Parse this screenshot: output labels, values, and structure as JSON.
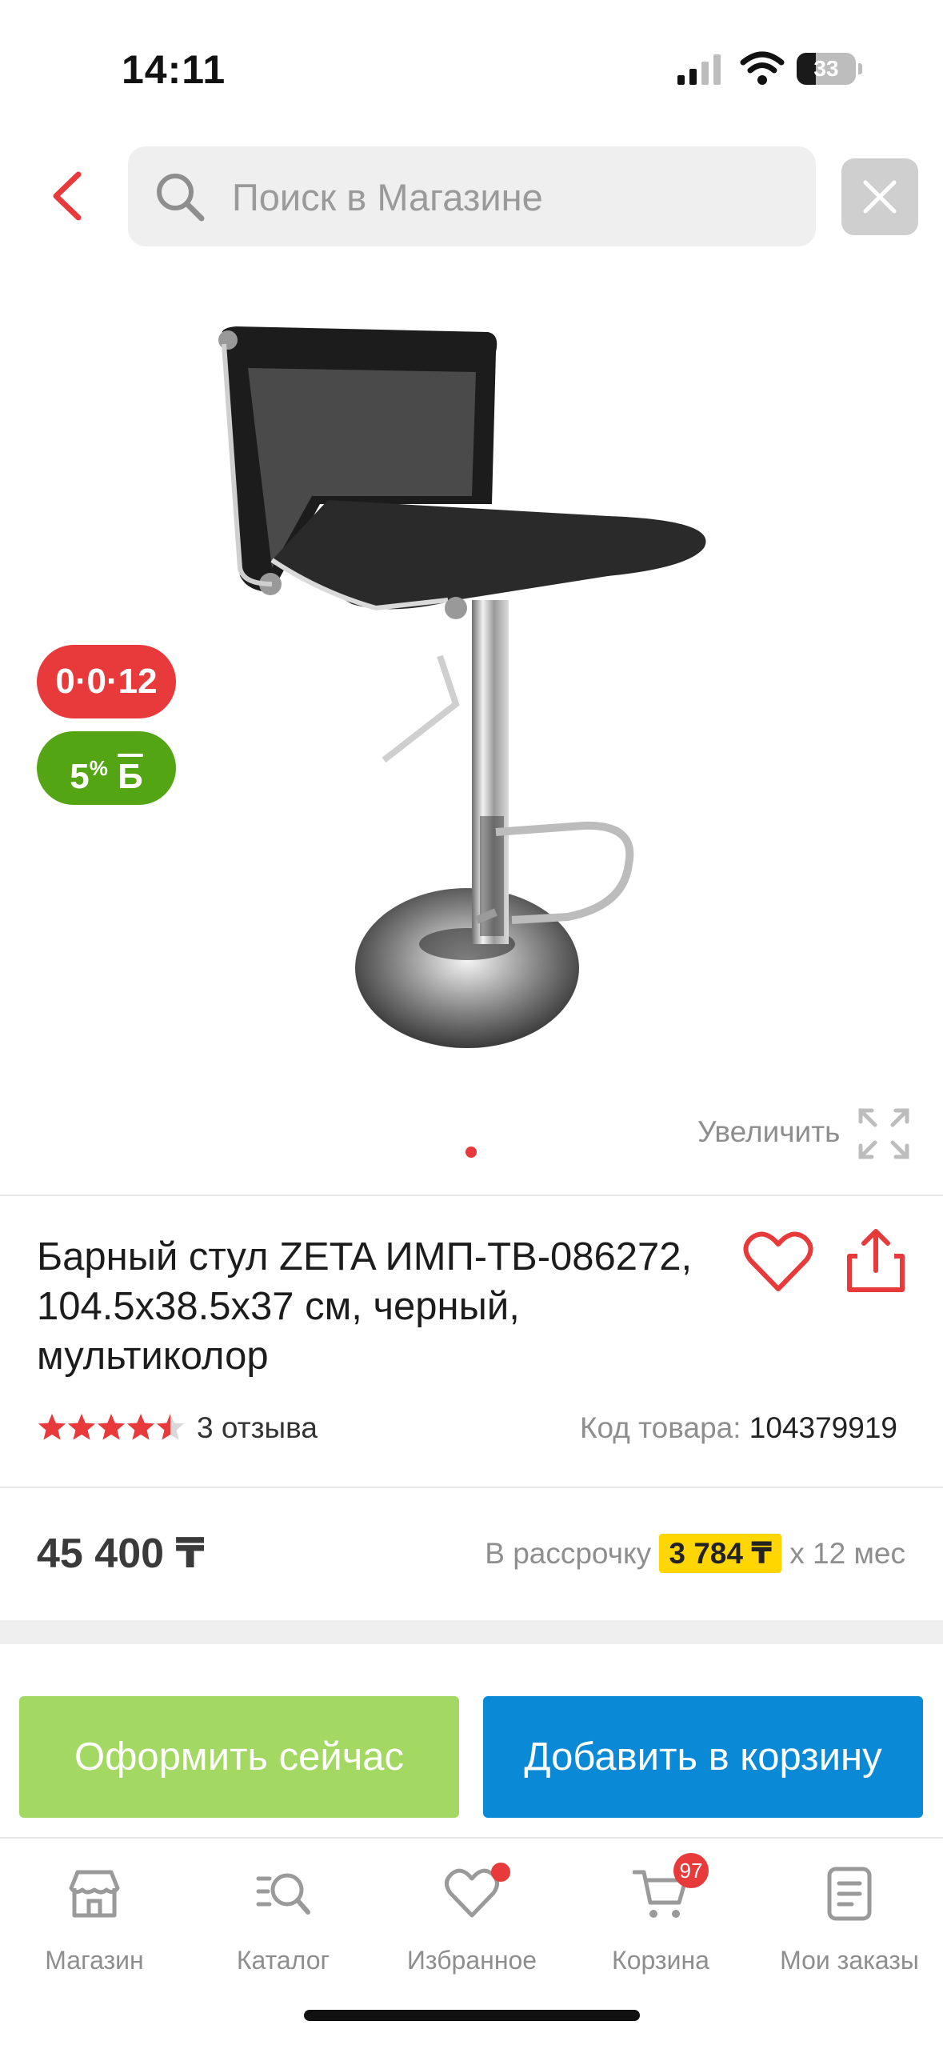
{
  "status_bar": {
    "time": "14:11",
    "battery": "33",
    "battery_level": 0.33
  },
  "search": {
    "placeholder": "Поиск в Магазине"
  },
  "icons": {
    "back": "chevron-left-icon",
    "search": "search-icon",
    "close": "close-icon",
    "zoom": "expand-icon",
    "favorite": "heart-icon",
    "share": "share-icon"
  },
  "badges": {
    "installment": "0·0·12",
    "bonus_value": "5",
    "bonus_suffix": "%",
    "bonus_currency": "Б"
  },
  "gallery": {
    "zoom_label": "Увеличить",
    "slides": 1,
    "active_slide": 1
  },
  "product": {
    "title": "Барный стул ZETA ИМП-ТВ-086272, 104.5x38.5x37 см, черный, мультиколор",
    "rating": 4.5,
    "reviews": "3 отзыва",
    "sku_label": "Код товара:",
    "sku_value": "104379919",
    "price": "45 400 ₸",
    "installment_label": "В рассрочку",
    "installment_amount": "3 784 ₸",
    "installment_term": "х 12 мес"
  },
  "actions": {
    "checkout": "Оформить сейчас",
    "add_to_cart": "Добавить в корзину"
  },
  "nav": [
    {
      "label": "Магазин",
      "icon": "store-icon"
    },
    {
      "label": "Каталог",
      "icon": "catalog-search-icon"
    },
    {
      "label": "Избранное",
      "icon": "heart-icon"
    },
    {
      "label": "Корзина",
      "icon": "cart-icon",
      "badge": "97"
    },
    {
      "label": "Мои заказы",
      "icon": "orders-icon"
    }
  ],
  "colors": {
    "accent_red": "#e8393b",
    "bonus_green": "#53a514",
    "checkout_green": "#a3d962",
    "cart_blue": "#0a8ad6",
    "installment_yellow": "#ffd600"
  }
}
